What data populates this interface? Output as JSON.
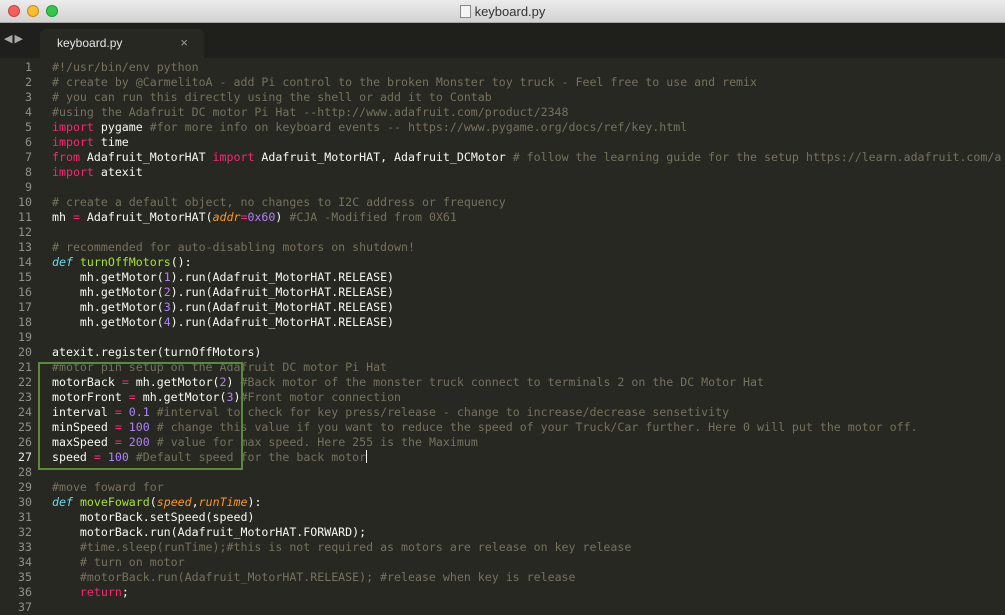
{
  "window": {
    "title": "keyboard.py",
    "file_icon": "python-file-icon"
  },
  "tabbar": {
    "nav_left": "◀",
    "nav_right": "▶",
    "tab_label": "keyboard.py",
    "tab_close": "×"
  },
  "editor": {
    "active_line": 27,
    "highlight_box": {
      "from_line": 22,
      "to_line": 27,
      "color": "#5a8a3c"
    },
    "lines": [
      {
        "n": "1",
        "s": [
          [
            "c",
            "#!/usr/bin/env python"
          ]
        ]
      },
      {
        "n": "2",
        "s": [
          [
            "c",
            "# create by @CarmelitoA - add Pi control to the broken Monster toy truck - Feel free to use and remix"
          ]
        ]
      },
      {
        "n": "3",
        "s": [
          [
            "c",
            "# you can run this directly using the shell or add it to Contab"
          ]
        ]
      },
      {
        "n": "4",
        "s": [
          [
            "c",
            "#using the Adafruit DC motor Pi Hat --http://www.adafruit.com/product/2348"
          ]
        ]
      },
      {
        "n": "5",
        "s": [
          [
            "k",
            "import"
          ],
          [
            "t",
            " pygame "
          ],
          [
            "c",
            "#for more info on keyboard events -- https://www.pygame.org/docs/ref/key.html"
          ]
        ]
      },
      {
        "n": "6",
        "s": [
          [
            "k",
            "import"
          ],
          [
            "t",
            " time"
          ]
        ]
      },
      {
        "n": "7",
        "s": [
          [
            "k",
            "from"
          ],
          [
            "t",
            " Adafruit_MotorHAT "
          ],
          [
            "k",
            "import"
          ],
          [
            "t",
            " Adafruit_MotorHAT, Adafruit_DCMotor "
          ],
          [
            "c",
            "# follow the learning guide for the setup https://learn.adafruit.com/a"
          ]
        ]
      },
      {
        "n": "8",
        "s": [
          [
            "k",
            "import"
          ],
          [
            "t",
            " atexit"
          ]
        ]
      },
      {
        "n": "9",
        "s": []
      },
      {
        "n": "10",
        "s": [
          [
            "c",
            "# create a default object, no changes to I2C address or frequency"
          ]
        ]
      },
      {
        "n": "11",
        "s": [
          [
            "t",
            "mh "
          ],
          [
            "k",
            "="
          ],
          [
            "t",
            " Adafruit_MotorHAT("
          ],
          [
            "p",
            "addr"
          ],
          [
            "k",
            "="
          ],
          [
            "n",
            "0x60"
          ],
          [
            "t",
            ") "
          ],
          [
            "c",
            "#CJA -Modified from 0X61"
          ]
        ]
      },
      {
        "n": "12",
        "s": []
      },
      {
        "n": "13",
        "s": [
          [
            "c",
            "# recommended for auto-disabling motors on shutdown!"
          ]
        ]
      },
      {
        "n": "14",
        "s": [
          [
            "d",
            "def"
          ],
          [
            "t",
            " "
          ],
          [
            "f",
            "turnOffMotors"
          ],
          [
            "t",
            "():"
          ]
        ]
      },
      {
        "n": "15",
        "s": [
          [
            "t",
            "    mh.getMotor("
          ],
          [
            "n",
            "1"
          ],
          [
            "t",
            ").run(Adafruit_MotorHAT.RELEASE)"
          ]
        ]
      },
      {
        "n": "16",
        "s": [
          [
            "t",
            "    mh.getMotor("
          ],
          [
            "n",
            "2"
          ],
          [
            "t",
            ").run(Adafruit_MotorHAT.RELEASE)"
          ]
        ]
      },
      {
        "n": "17",
        "s": [
          [
            "t",
            "    mh.getMotor("
          ],
          [
            "n",
            "3"
          ],
          [
            "t",
            ").run(Adafruit_MotorHAT.RELEASE)"
          ]
        ]
      },
      {
        "n": "18",
        "s": [
          [
            "t",
            "    mh.getMotor("
          ],
          [
            "n",
            "4"
          ],
          [
            "t",
            ").run(Adafruit_MotorHAT.RELEASE)"
          ]
        ]
      },
      {
        "n": "19",
        "s": []
      },
      {
        "n": "20",
        "s": [
          [
            "t",
            "atexit.register(turnOffMotors)"
          ]
        ]
      },
      {
        "n": "21",
        "s": [
          [
            "c",
            "#motor pin setup on the Adafruit DC motor Pi Hat"
          ]
        ]
      },
      {
        "n": "22",
        "s": [
          [
            "t",
            "motorBack "
          ],
          [
            "k",
            "="
          ],
          [
            "t",
            " mh.getMotor("
          ],
          [
            "n",
            "2"
          ],
          [
            "t",
            ") "
          ],
          [
            "c",
            "#Back motor of the monster truck connect to terminals 2 on the DC Motor Hat"
          ]
        ]
      },
      {
        "n": "23",
        "s": [
          [
            "t",
            "motorFront "
          ],
          [
            "k",
            "="
          ],
          [
            "t",
            " mh.getMotor("
          ],
          [
            "n",
            "3"
          ],
          [
            "t",
            ")"
          ],
          [
            "c",
            "#Front motor connection"
          ]
        ]
      },
      {
        "n": "24",
        "s": [
          [
            "t",
            "interval "
          ],
          [
            "k",
            "="
          ],
          [
            "t",
            " "
          ],
          [
            "n",
            "0.1"
          ],
          [
            "t",
            " "
          ],
          [
            "c",
            "#interval to check for key press/release - change to increase/decrease sensetivity"
          ]
        ]
      },
      {
        "n": "25",
        "s": [
          [
            "t",
            "minSpeed "
          ],
          [
            "k",
            "="
          ],
          [
            "t",
            " "
          ],
          [
            "n",
            "100"
          ],
          [
            "t",
            " "
          ],
          [
            "c",
            "# change this value if you want to reduce the speed of your Truck/Car further. Here 0 will put the motor off."
          ]
        ]
      },
      {
        "n": "26",
        "s": [
          [
            "t",
            "maxSpeed "
          ],
          [
            "k",
            "="
          ],
          [
            "t",
            " "
          ],
          [
            "n",
            "200"
          ],
          [
            "t",
            " "
          ],
          [
            "c",
            "# value for max speed. Here 255 is the Maximum"
          ]
        ]
      },
      {
        "n": "27",
        "s": [
          [
            "t",
            "speed "
          ],
          [
            "k",
            "="
          ],
          [
            "t",
            " "
          ],
          [
            "n",
            "100"
          ],
          [
            "t",
            " "
          ],
          [
            "c",
            "#Default speed for the back motor"
          ]
        ]
      },
      {
        "n": "28",
        "s": []
      },
      {
        "n": "29",
        "s": [
          [
            "c",
            "#move foward for"
          ]
        ]
      },
      {
        "n": "30",
        "s": [
          [
            "d",
            "def"
          ],
          [
            "t",
            " "
          ],
          [
            "f",
            "moveFoward"
          ],
          [
            "t",
            "("
          ],
          [
            "p",
            "speed"
          ],
          [
            "t",
            ","
          ],
          [
            "p",
            "runTime"
          ],
          [
            "t",
            "):"
          ]
        ]
      },
      {
        "n": "31",
        "s": [
          [
            "t",
            "    motorBack.setSpeed(speed)"
          ]
        ]
      },
      {
        "n": "32",
        "s": [
          [
            "t",
            "    motorBack.run(Adafruit_MotorHAT.FORWARD);"
          ]
        ]
      },
      {
        "n": "33",
        "s": [
          [
            "t",
            "    "
          ],
          [
            "c",
            "#time.sleep(runTime);#this is not required as motors are release on key release"
          ]
        ]
      },
      {
        "n": "34",
        "s": [
          [
            "t",
            "    "
          ],
          [
            "c",
            "# turn on motor"
          ]
        ]
      },
      {
        "n": "35",
        "s": [
          [
            "t",
            "    "
          ],
          [
            "c",
            "#motorBack.run(Adafruit_MotorHAT.RELEASE); #release when key is release"
          ]
        ]
      },
      {
        "n": "36",
        "s": [
          [
            "t",
            "    "
          ],
          [
            "k",
            "return"
          ],
          [
            "t",
            ";"
          ]
        ]
      },
      {
        "n": "37",
        "s": []
      }
    ]
  }
}
